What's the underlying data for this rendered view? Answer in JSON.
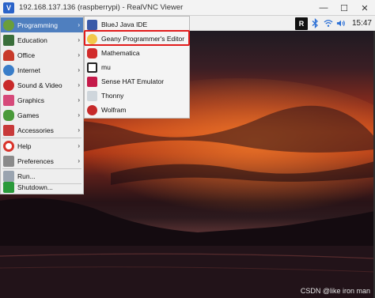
{
  "window": {
    "title": "192.168.137.136 (raspberrypi) - RealVNC Viewer",
    "controls": [
      "—",
      "☐",
      "✕"
    ]
  },
  "taskbar": {
    "tray_app": "R",
    "clock": "15:47"
  },
  "menu": {
    "items": [
      {
        "label": "Programming",
        "icon": "programming-icon",
        "arrow": "›",
        "selected": true
      },
      {
        "label": "Education",
        "icon": "education-icon",
        "arrow": "›"
      },
      {
        "label": "Office",
        "icon": "office-icon",
        "arrow": "›"
      },
      {
        "label": "Internet",
        "icon": "internet-icon",
        "arrow": "›"
      },
      {
        "label": "Sound & Video",
        "icon": "sound-video-icon",
        "arrow": "›"
      },
      {
        "label": "Graphics",
        "icon": "graphics-icon",
        "arrow": "›"
      },
      {
        "label": "Games",
        "icon": "games-icon",
        "arrow": "›"
      },
      {
        "label": "Accessories",
        "icon": "accessories-icon",
        "arrow": "›"
      },
      {
        "label": "Help",
        "icon": "help-icon",
        "arrow": "›"
      },
      {
        "label": "Preferences",
        "icon": "preferences-icon",
        "arrow": "›"
      },
      {
        "label": "Run...",
        "icon": "run-icon"
      },
      {
        "label": "Shutdown...",
        "icon": "shutdown-icon"
      }
    ]
  },
  "submenu": {
    "items": [
      {
        "label": "BlueJ Java IDE",
        "icon": "bluej-icon"
      },
      {
        "label": "Geany Programmer's Editor",
        "icon": "geany-icon"
      },
      {
        "label": "Mathematica",
        "icon": "mathematica-icon"
      },
      {
        "label": "mu",
        "icon": "mu-icon"
      },
      {
        "label": "Sense HAT Emulator",
        "icon": "sense-hat-icon"
      },
      {
        "label": "Thonny",
        "icon": "thonny-icon"
      },
      {
        "label": "Wolfram",
        "icon": "wolfram-icon"
      }
    ]
  },
  "watermark": "CSDN @like iron man",
  "colors": {
    "selection": "#4f7fbf",
    "highlight_box": "#e21b1b",
    "menu_bg": "#eeeeee"
  }
}
